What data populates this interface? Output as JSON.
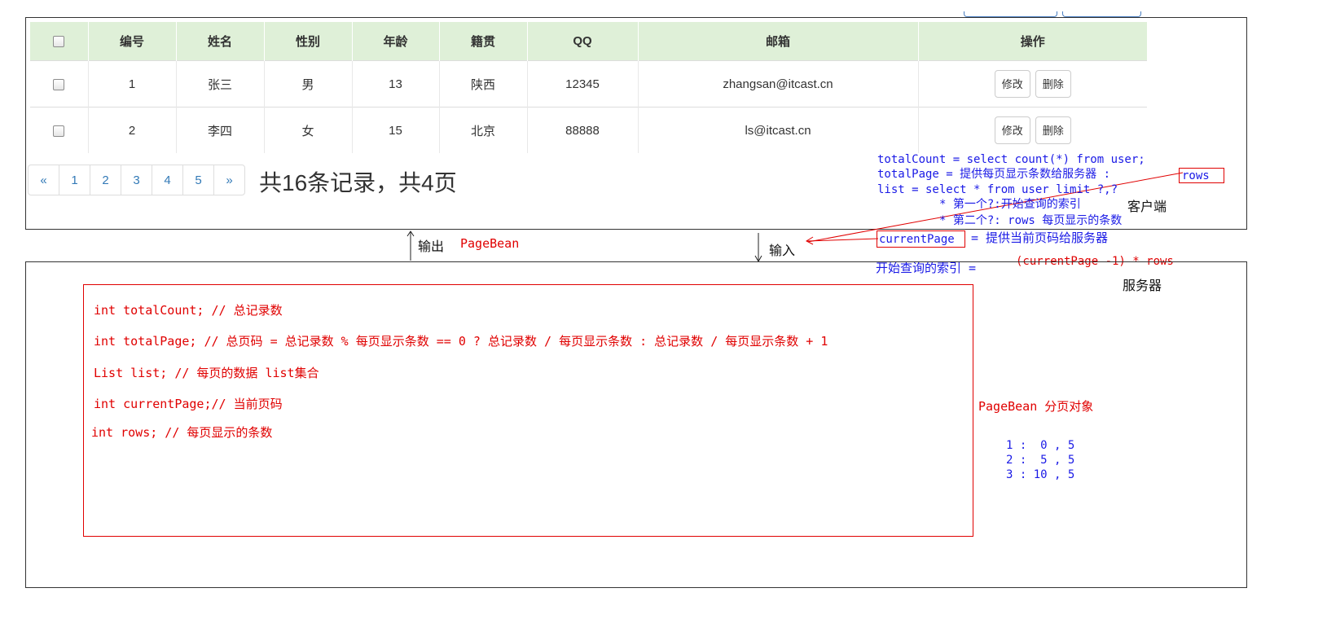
{
  "table": {
    "headers": [
      "编号",
      "姓名",
      "性别",
      "年龄",
      "籍贯",
      "QQ",
      "邮箱",
      "操作"
    ],
    "rows": [
      {
        "id": "1",
        "name": "张三",
        "gender": "男",
        "age": "13",
        "hometown": "陕西",
        "qq": "12345",
        "email": "zhangsan@itcast.cn",
        "edit_label": "修改",
        "delete_label": "删除"
      },
      {
        "id": "2",
        "name": "李四",
        "gender": "女",
        "age": "15",
        "hometown": "北京",
        "qq": "88888",
        "email": "ls@itcast.cn",
        "edit_label": "修改",
        "delete_label": "删除"
      }
    ]
  },
  "pagination": {
    "prev": "«",
    "pages": [
      "1",
      "2",
      "3",
      "4",
      "5"
    ],
    "next": "»",
    "summary": "共16条记录，共4页"
  },
  "arrows": {
    "output_label": "输出",
    "output_type": "PageBean",
    "input_label": "输入"
  },
  "notes": {
    "total_count": "totalCount = select count(*) from user;",
    "total_page_prefix": "totalPage = 提供每页显示条数给服务器 :",
    "rows_word": "rows",
    "list_query": "list = select * from user limit ?,?",
    "first_param": "* 第一个?:开始查询的索引",
    "client_label": "客户端",
    "second_param": "* 第二个?: rows 每页显示的条数",
    "current_page_word": "currentPage",
    "current_page_suffix": "= 提供当前页码给服务器",
    "start_index_label": "开始查询的索引 =",
    "start_index_formula": "(currentPage -1) * rows",
    "server_label": "服务器"
  },
  "page_bean": {
    "fields": [
      "int totalCount; // 总记录数",
      "int totalPage; // 总页码 = 总记录数 % 每页显示条数 == 0 ? 总记录数 / 每页显示条数 : 总记录数 / 每页显示条数 + 1",
      "List list;  // 每页的数据 list集合",
      "int currentPage;// 当前页码",
      "int rows; // 每页显示的条数"
    ],
    "label": "PageBean 分页对象",
    "examples": [
      "1 :  0 , 5",
      "2 :  5 , 5",
      "3 : 10 , 5"
    ]
  },
  "colors": {
    "header_bg": "#dff0d8",
    "link_blue": "#337ab7",
    "annotation_red": "#e00000",
    "annotation_blue": "#1a1ae6"
  }
}
